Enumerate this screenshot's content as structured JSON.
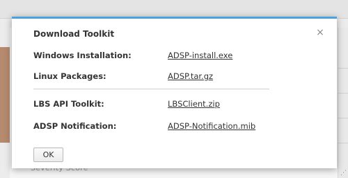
{
  "background": {
    "footer_text": "Severity Score"
  },
  "dialog": {
    "title": "Download Toolkit",
    "close_symbol": "×",
    "rows": [
      {
        "label": "Windows Installation:",
        "link": "ADSP-install.exe"
      },
      {
        "label": "Linux Packages:",
        "link": "ADSP.tar.gz"
      },
      {
        "label": "LBS API Toolkit:",
        "link": "LBSClient.zip"
      },
      {
        "label": "ADSP Notification:",
        "link": "ADSP-Notification.mib"
      }
    ],
    "ok_label": "OK"
  },
  "colors": {
    "accent": "#4aa3df",
    "text": "#333333",
    "close": "#888888"
  }
}
